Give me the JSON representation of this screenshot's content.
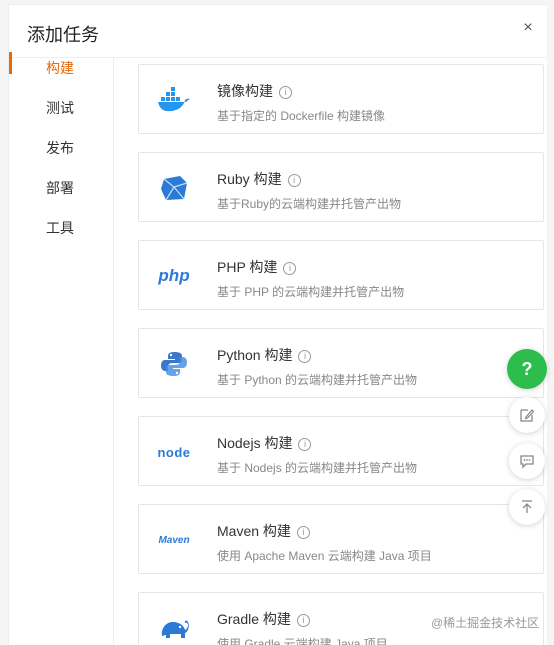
{
  "dialog": {
    "title": "添加任务",
    "close_label": "×"
  },
  "sidebar": {
    "items": [
      {
        "label": "构建",
        "active": true
      },
      {
        "label": "测试"
      },
      {
        "label": "发布"
      },
      {
        "label": "部署"
      },
      {
        "label": "工具"
      }
    ]
  },
  "cards": [
    {
      "name": "镜像构建",
      "desc": "基于指定的 Dockerfile 构建镜像",
      "icon": "docker-icon"
    },
    {
      "name": "Ruby 构建",
      "desc": "基于Ruby的云端构建并托管产出物",
      "icon": "ruby-icon"
    },
    {
      "name": "PHP 构建",
      "desc": "基于 PHP 的云端构建并托管产出物",
      "icon": "php-icon",
      "logo_text": "php"
    },
    {
      "name": "Python 构建",
      "desc": "基于 Python 的云端构建并托管产出物",
      "icon": "python-icon"
    },
    {
      "name": "Nodejs 构建",
      "desc": "基于 Nodejs 的云端构建并托管产出物",
      "icon": "nodejs-icon",
      "logo_text": "node"
    },
    {
      "name": "Maven 构建",
      "desc": "使用 Apache Maven 云端构建 Java 项目",
      "icon": "maven-icon",
      "logo_text": "Maven"
    },
    {
      "name": "Gradle 构建",
      "desc": "使用 Gradle 云端构建 Java 项目",
      "icon": "gradle-icon"
    }
  ],
  "info_glyph": "i",
  "floating": {
    "help_label": "?"
  },
  "watermark": "@稀土掘金技术社区",
  "colors": {
    "accent": "#e8690c",
    "help": "#2dbd4c"
  }
}
